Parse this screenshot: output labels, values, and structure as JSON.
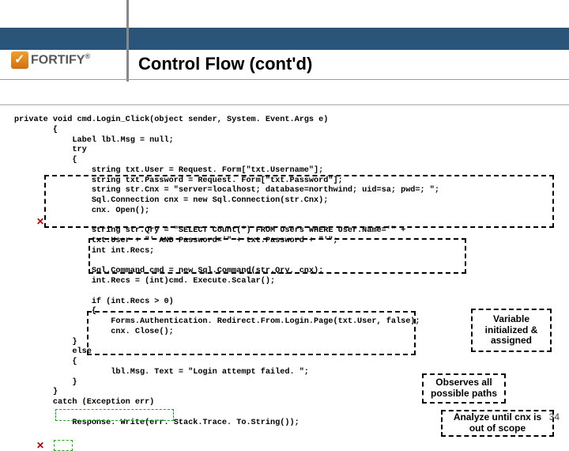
{
  "logo": {
    "text": "ORTIFY"
  },
  "title": "Control Flow (cont'd)",
  "code": {
    "l1": "private void cmd.Login_Click(object sender, System. Event.Args e)",
    "l2": "        {",
    "l3": "            Label lbl.Msg = null;",
    "l4": "            try",
    "l5": "            {",
    "l6": "                string txt.User = Request. Form[\"txt.Username\"];",
    "l7": "                string txt.Password = Request. Form[\"txt.Password\"];",
    "l8": "                string str.Cnx = \"server=localhost; database=northwind; uid=sa; pwd=; \";",
    "l9": "                Sql.Connection cnx = new Sql.Connection(str.Cnx);",
    "l10": "                cnx. Open();",
    "l11": "",
    "l12": "                string str.Qry = \"SELECT Count(*) FROM Users WHERE User.Name='\" +",
    "l13": "                txt.User + \"' AND Password='\" + txt.Password + \"'\";",
    "l14": "                int int.Recs;",
    "l15": "",
    "l16": "                Sql.Command cmd = new Sql.Command(str.Qry, cnx);",
    "l17": "                int.Recs = (int)cmd. Execute.Scalar();",
    "l18": "",
    "l19": "                if (int.Recs > 0)",
    "l20": "                {",
    "l21": "                    Forms.Authentication. Redirect.From.Login.Page(txt.User, false);",
    "l22": "                    cnx. Close();",
    "l23": "            }",
    "l24": "            else",
    "l25": "            {",
    "l26": "                    lbl.Msg. Text = \"Login attempt failed. \";",
    "l27": "            }",
    "l28": "        }",
    "l29": "        catch (Exception err)",
    "l30": "",
    "l31": "            Response. Write(err. Stack.Trace. To.String());"
  },
  "annot": {
    "variable": "Variable initialized & assigned",
    "observes": "Observes all possible paths",
    "analyze": "Analyze until cnx is out of scope"
  },
  "page": "34"
}
